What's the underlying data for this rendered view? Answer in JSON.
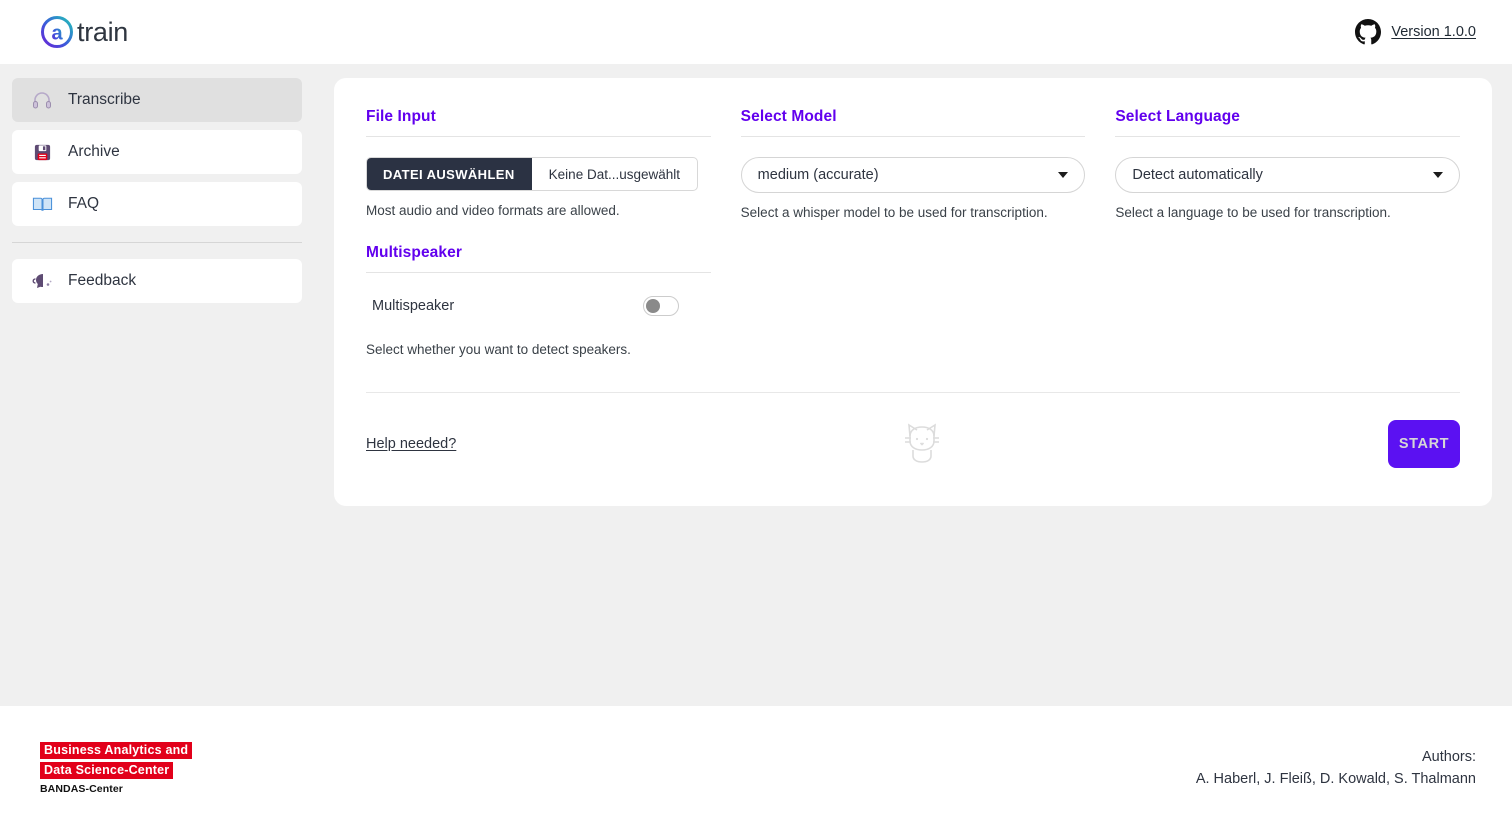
{
  "header": {
    "logo_text": "train",
    "logo_icon": "atrain-circle-a-logo",
    "github_icon": "github-icon",
    "version_label": "Version 1.0.0"
  },
  "sidebar": {
    "items": [
      {
        "label": "Transcribe",
        "icon": "headphones-icon",
        "selected": true
      },
      {
        "label": "Archive",
        "icon": "floppy-disk-icon",
        "selected": false
      },
      {
        "label": "FAQ",
        "icon": "open-book-icon",
        "selected": false
      },
      {
        "label": "Feedback",
        "icon": "speaking-head-icon",
        "selected": false
      }
    ]
  },
  "main": {
    "file_input": {
      "title": "File Input",
      "button_label": "DATEI AUSWÄHLEN",
      "file_name": "Keine Dat...usgewählt",
      "helper": "Most audio and video formats are allowed."
    },
    "select_model": {
      "title": "Select Model",
      "value": "medium (accurate)",
      "helper": "Select a whisper model to be used for transcription."
    },
    "select_language": {
      "title": "Select Language",
      "value": "Detect automatically",
      "helper": "Select a language to be used for transcription."
    },
    "multispeaker": {
      "title": "Multispeaker",
      "row_label": "Multispeaker",
      "toggle_state": "off",
      "helper": "Select whether you want to detect speakers."
    },
    "bottom": {
      "help_link": "Help needed?",
      "mascot_icon": "cat-mascot-icon",
      "start_label": "START"
    }
  },
  "footer": {
    "bandas_line1": "Business Analytics and",
    "bandas_line2": "Data Science-Center",
    "bandas_sub": "BANDAS-Center",
    "authors_label": "Authors:",
    "authors_names": "A. Haberl, J. Fleiß, D. Kowald, S. Thalmann"
  },
  "colors": {
    "accent_purple": "#6200ee",
    "start_button": "#5b11f2",
    "file_button_dark": "#2b3243",
    "bandas_red": "#e2001a",
    "page_background": "#f0f0f0"
  }
}
